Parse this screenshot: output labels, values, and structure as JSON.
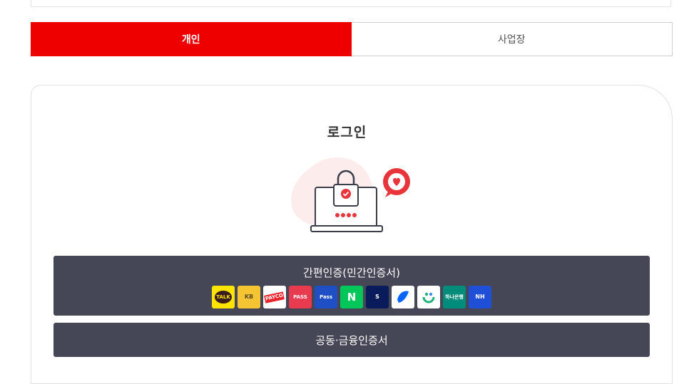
{
  "tabs": {
    "personal": "개인",
    "business": "사업장"
  },
  "login": {
    "title": "로그인"
  },
  "simple_cert": {
    "label": "간편인증(민간인증서)",
    "providers": [
      {
        "name": "kakao-icon",
        "text": "TALK",
        "bg": "#fee500",
        "fg": "#3a1d1d"
      },
      {
        "name": "kb-icon",
        "text": "KB",
        "bg": "#f5c433",
        "fg": "#5a4a2a"
      },
      {
        "name": "payco-icon",
        "text": "PAYCO",
        "bg": "#ffffff",
        "fg": "#e8232a"
      },
      {
        "name": "pass-icon",
        "text": "PASS",
        "bg": "#e83b4f",
        "fg": "#ffffff"
      },
      {
        "name": "samsung-pass-icon",
        "text": "Pass",
        "bg": "#1f4fc4",
        "fg": "#ffffff"
      },
      {
        "name": "naver-icon",
        "text": "N",
        "bg": "#03c75a",
        "fg": "#ffffff"
      },
      {
        "name": "shinhan-icon",
        "text": "S",
        "bg": "#0a1b5c",
        "fg": "#ffffff"
      },
      {
        "name": "toss-icon",
        "text": "",
        "bg": "#ffffff",
        "fg": "#0064ff"
      },
      {
        "name": "banksalad-icon",
        "text": "",
        "bg": "#ffffff",
        "fg": "#1fb37a"
      },
      {
        "name": "hana-icon",
        "text": "하나은행",
        "bg": "#008c7a",
        "fg": "#ffffff"
      },
      {
        "name": "nh-icon",
        "text": "NH",
        "bg": "#1e4fd6",
        "fg": "#ffffff"
      }
    ]
  },
  "joint_cert": {
    "label": "공동·금융인증서"
  },
  "colors": {
    "accent": "#ee0000",
    "button_bg": "#454757"
  }
}
